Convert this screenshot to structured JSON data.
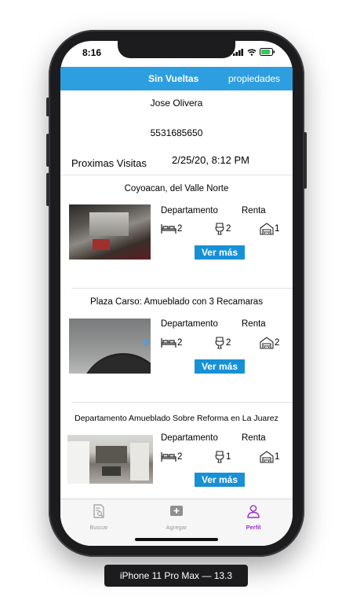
{
  "status_bar": {
    "time": "8:16"
  },
  "navbar": {
    "title": "Sin Vueltas",
    "right_link": "propiedades"
  },
  "profile": {
    "name": "Jose Olivera",
    "phone": "5531685650"
  },
  "visits": {
    "label": "Proximas Visitas",
    "date": "2/25/20, 8:12 PM"
  },
  "listings": [
    {
      "title": "Coyoacan, del Valle Norte",
      "type": "Departamento",
      "operation": "Renta",
      "bedrooms": "2",
      "bathrooms": "2",
      "parking": "1",
      "button": "Ver más"
    },
    {
      "title": "Plaza Carso: Amueblado con 3 Recamaras",
      "type": "Departamento",
      "operation": "Renta",
      "bedrooms": "2",
      "bathrooms": "2",
      "parking": "2",
      "button": "Ver más"
    },
    {
      "title": "Departamento Amueblado Sobre Reforma en La Juarez",
      "type": "Departamento",
      "operation": "Renta",
      "bedrooms": "2",
      "bathrooms": "1",
      "parking": "1",
      "button": "Ver más"
    }
  ],
  "tabbar": {
    "items": [
      {
        "label": "Buscar",
        "icon": "search-document-icon"
      },
      {
        "label": "Agregar",
        "icon": "add-square-icon"
      },
      {
        "label": "Perfil",
        "icon": "person-icon",
        "active": true
      }
    ]
  },
  "device_caption": "iPhone 11 Pro Max — 13.3",
  "colors": {
    "navbar": "#2d9fe0",
    "button": "#1790d6",
    "active_tab": "#9b2ec9",
    "inactive_tab": "#9a9a9a"
  }
}
